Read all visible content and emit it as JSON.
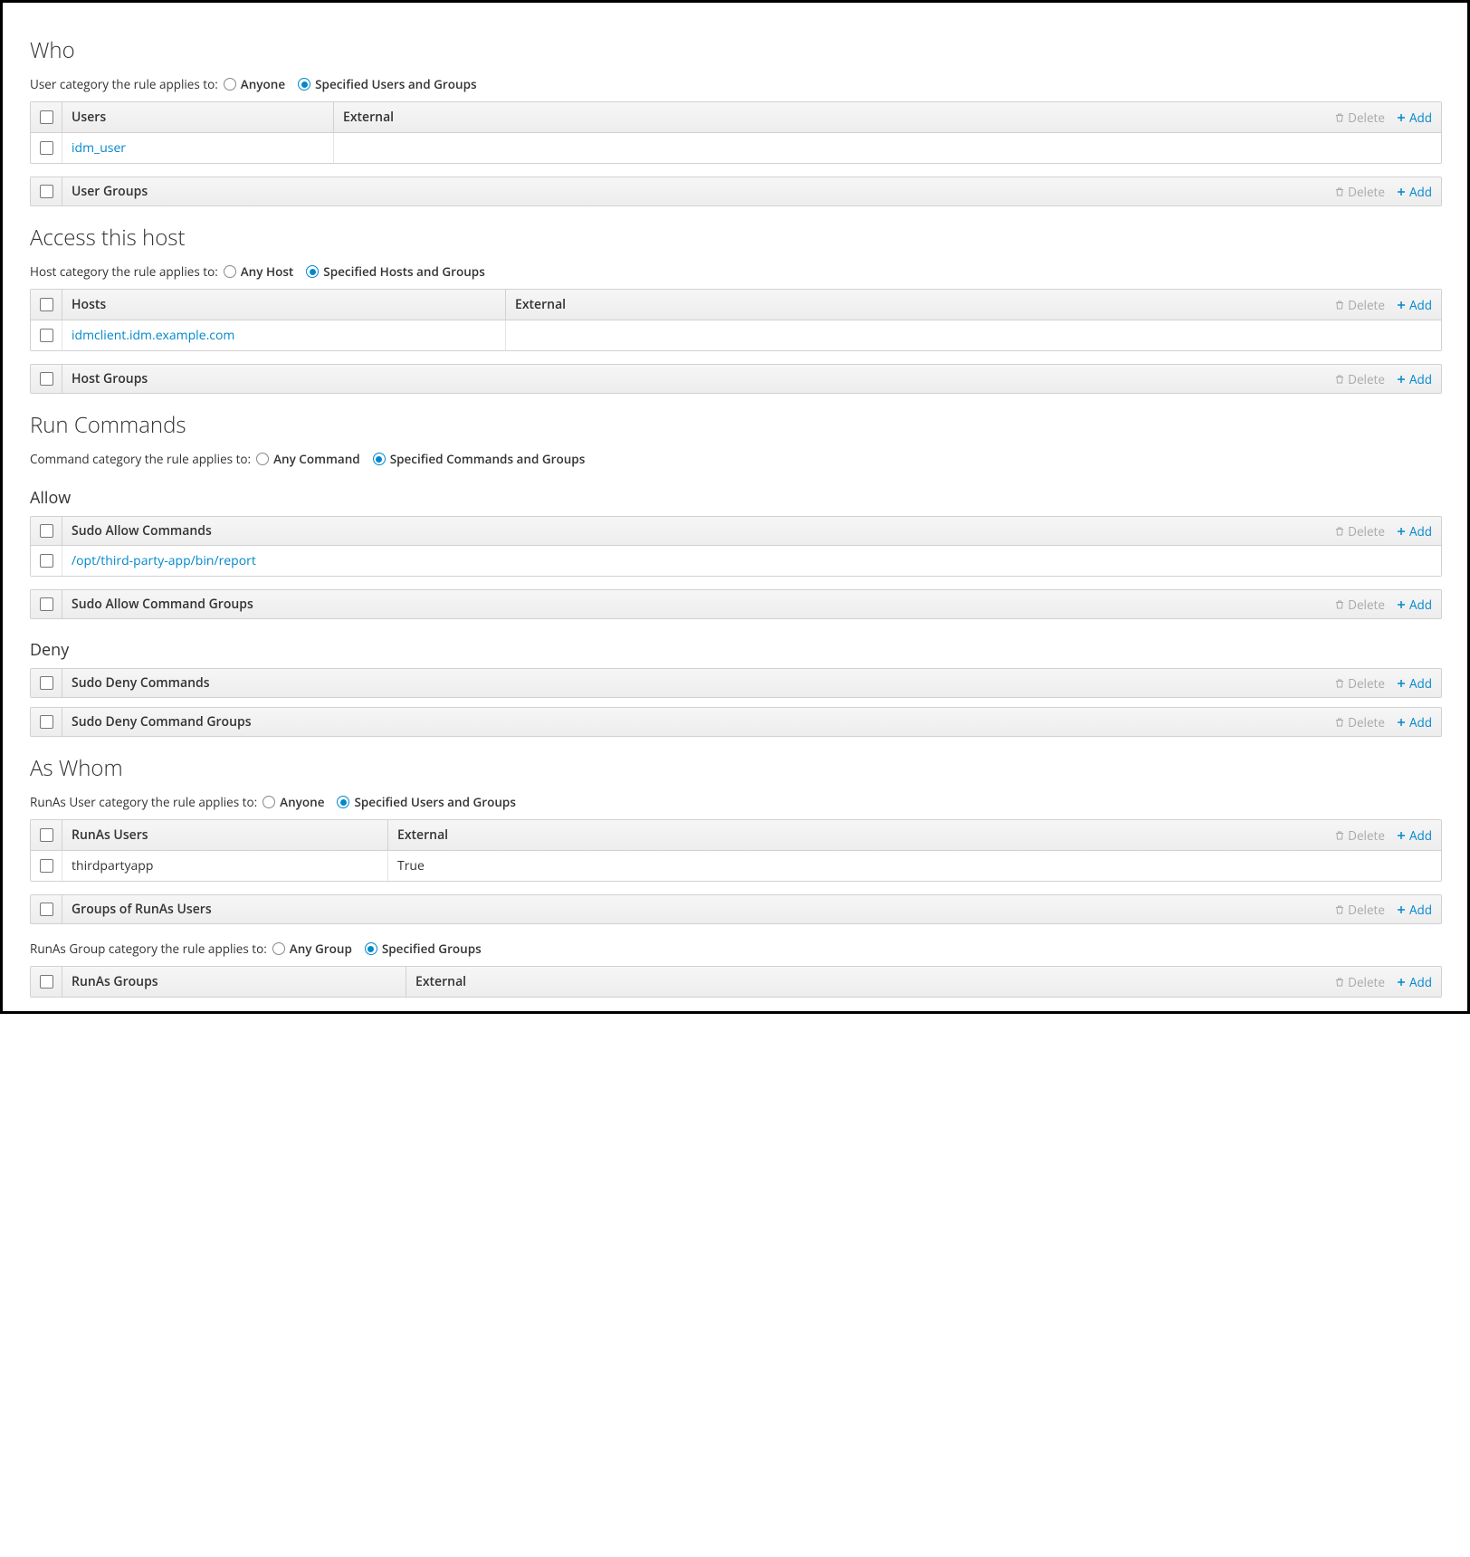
{
  "actions": {
    "delete": "Delete",
    "add": "Add"
  },
  "who": {
    "heading": "Who",
    "cat_label": "User category the rule applies to:",
    "opt_any": "Anyone",
    "opt_spec": "Specified Users and Groups",
    "selected": "spec",
    "users": {
      "header_main": "Users",
      "header_external": "External",
      "rows": [
        {
          "name": "idm_user",
          "external": ""
        }
      ]
    },
    "user_groups": {
      "header_main": "User Groups"
    }
  },
  "hosts": {
    "heading": "Access this host",
    "cat_label": "Host category the rule applies to:",
    "opt_any": "Any Host",
    "opt_spec": "Specified Hosts and Groups",
    "selected": "spec",
    "hosts": {
      "header_main": "Hosts",
      "header_external": "External",
      "rows": [
        {
          "name": "idmclient.idm.example.com",
          "external": ""
        }
      ]
    },
    "host_groups": {
      "header_main": "Host Groups"
    }
  },
  "run": {
    "heading": "Run Commands",
    "cat_label": "Command category the rule applies to:",
    "opt_any": "Any Command",
    "opt_spec": "Specified Commands and Groups",
    "selected": "spec",
    "allow": {
      "subheading": "Allow",
      "cmds": {
        "header_main": "Sudo Allow Commands",
        "rows": [
          {
            "name": "/opt/third-party-app/bin/report"
          }
        ]
      },
      "cmd_groups": {
        "header_main": "Sudo Allow Command Groups"
      }
    },
    "deny": {
      "subheading": "Deny",
      "cmds": {
        "header_main": "Sudo Deny Commands"
      },
      "cmd_groups": {
        "header_main": "Sudo Deny Command Groups"
      }
    }
  },
  "aswhom": {
    "heading": "As Whom",
    "user_cat_label": "RunAs User category the rule applies to:",
    "user_opt_any": "Anyone",
    "user_opt_spec": "Specified Users and Groups",
    "user_selected": "spec",
    "runas_users": {
      "header_main": "RunAs Users",
      "header_external": "External",
      "rows": [
        {
          "name": "thirdpartyapp",
          "external": "True"
        }
      ]
    },
    "groups_runas_users": {
      "header_main": "Groups of RunAs Users"
    },
    "group_cat_label": "RunAs Group category the rule applies to:",
    "group_opt_any": "Any Group",
    "group_opt_spec": "Specified Groups",
    "group_selected": "spec",
    "runas_groups": {
      "header_main": "RunAs Groups",
      "header_external": "External"
    }
  }
}
